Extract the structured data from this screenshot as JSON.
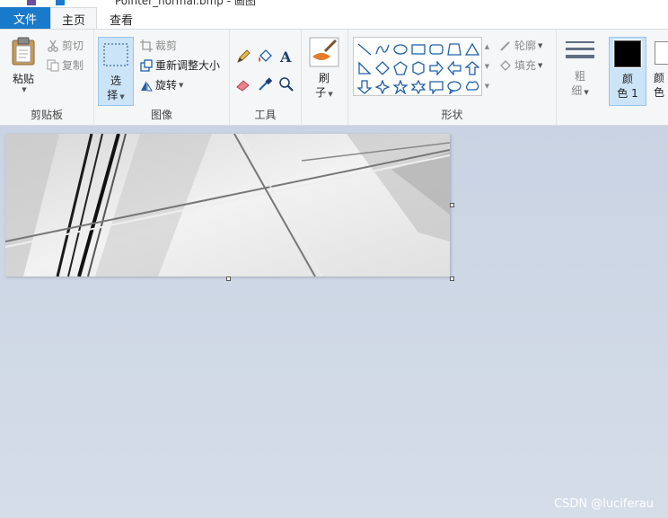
{
  "titlebar": {
    "title": "Pointer_normal.bmp - 画图"
  },
  "tabs": [
    {
      "label": "文件"
    },
    {
      "label": "主页"
    },
    {
      "label": "查看"
    }
  ],
  "ribbon": {
    "clipboard": {
      "label": "剪贴板",
      "paste_top": "粘贴",
      "cut": "剪切",
      "copy": "复制"
    },
    "image": {
      "label": "图像",
      "select_top": "选",
      "select_bottom": "择",
      "crop": "裁剪",
      "resize": "重新调整大小",
      "rotate": "旋转"
    },
    "tools": {
      "label": "工具"
    },
    "brush": {
      "top": "刷",
      "bottom": "子"
    },
    "shapes": {
      "label": "形状",
      "outline": "轮廓",
      "fill": "填充"
    },
    "size": {
      "top": "粗",
      "bottom": "细"
    },
    "color1": {
      "top": "颜",
      "bottom": "色 1",
      "value": "#000000"
    },
    "color2": {
      "top": "颜",
      "bottom": "色",
      "value": "#ffffff"
    }
  },
  "watermark": "CSDN @luciferau",
  "colors": {
    "file_tab": "#1979ca",
    "ribbon_bg": "#f5f6f7",
    "workspace_bg": "#c9d3e2",
    "selected_tool": "#cce4f7",
    "canvas_bg": "#ececec"
  }
}
